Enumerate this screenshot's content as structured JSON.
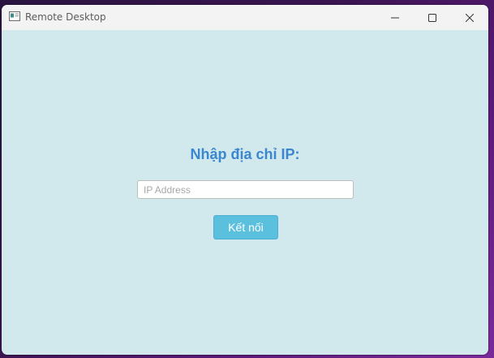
{
  "window": {
    "title": "Remote Desktop",
    "app_icon": "window-app-icon",
    "controls": {
      "minimize_icon": "minimize-icon",
      "maximize_icon": "maximize-icon",
      "close_icon": "close-icon"
    }
  },
  "form": {
    "heading": "Nhập địa chỉ IP:",
    "ip_input": {
      "value": "",
      "placeholder": "IP Address"
    },
    "connect_label": "Kết nối"
  },
  "colors": {
    "content_background": "#d1e9ed",
    "heading": "#3a86cf",
    "button": "#5bc0de",
    "button_text": "#ffffff"
  }
}
